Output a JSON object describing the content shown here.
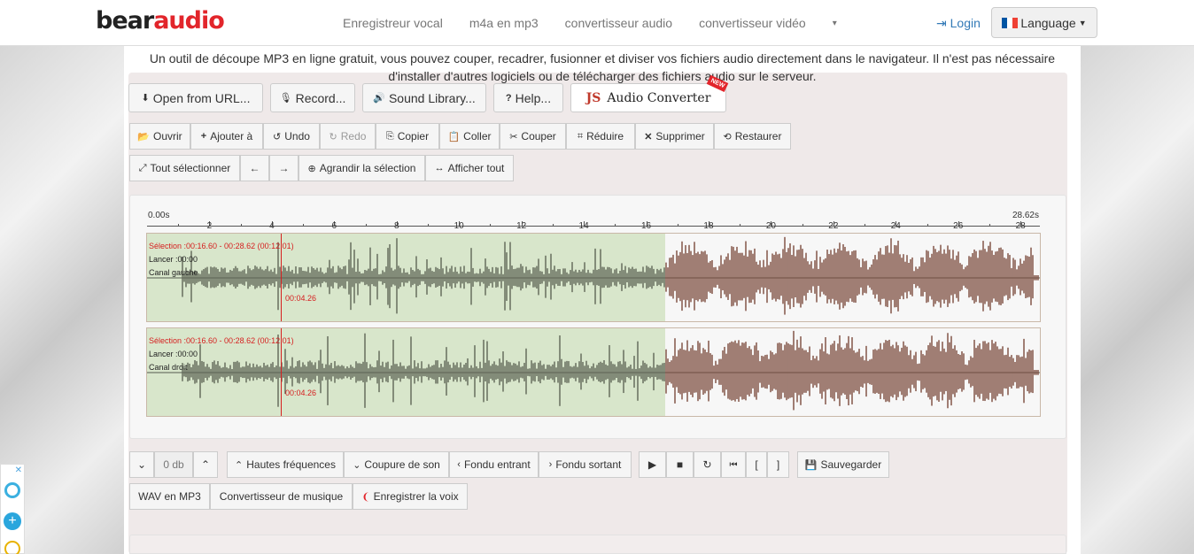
{
  "brand": {
    "logo_part1": "bear",
    "logo_part2": "audio"
  },
  "nav": {
    "links": [
      "Enregistreur vocal",
      "m4a en mp3",
      "convertisseur audio",
      "convertisseur vidéo"
    ],
    "dropdown_caret": "▾",
    "login": "Login",
    "language": "Language"
  },
  "intro_text": "Un outil de découpe MP3 en ligne gratuit, vous pouvez couper, recadrer, fusionner et diviser vos fichiers audio directement dans le navigateur. Il n'est pas nécessaire d'installer d'autres logiciels ou de télécharger des fichiers audio sur le serveur.",
  "source_buttons": {
    "open_url": "Open from URL...",
    "record": "Record...",
    "sound_library": "Sound Library...",
    "help": "Help...",
    "js_prefix": "JS",
    "audio_converter": "Audio Converter",
    "new_badge": "NEW"
  },
  "edit_toolbar": {
    "open": "Ouvrir",
    "append": "Ajouter à",
    "undo": "Undo",
    "redo": "Redo",
    "copy": "Copier",
    "paste": "Coller",
    "cut": "Couper",
    "crop": "Réduire",
    "delete": "Supprimer",
    "restore": "Restaurer"
  },
  "view_toolbar": {
    "select_all": "Tout sélectionner",
    "left_arrow": "←",
    "right_arrow": "→",
    "zoom_selection": "Agrandir la sélection",
    "show_all": "Afficher tout"
  },
  "timeline": {
    "start": "0.00s",
    "end": "28.62s",
    "ticks": [
      "2",
      "4",
      "6",
      "8",
      "10",
      "12",
      "14",
      "16",
      "18",
      "20",
      "22",
      "24",
      "26",
      "28"
    ]
  },
  "tracks": [
    {
      "selection": "Sélection :00:16.60 - 00:28.62 (00:12.01)",
      "play": "Lancer :00:00",
      "channel": "Canal gauche",
      "cursor_time": "00:04.26"
    },
    {
      "selection": "Sélection :00:16.60 - 00:28.62 (00:12.01)",
      "play": "Lancer :00:00",
      "channel": "Canal droit",
      "cursor_time": "00:04.26"
    }
  ],
  "effects_toolbar": {
    "volume_down": "⌄",
    "volume_value": "0 db",
    "volume_up": "⌃",
    "high_freq": "Hautes fréquences",
    "bass_cut": "Coupure de son",
    "fade_in": "Fondu entrant",
    "fade_out": "Fondu sortant",
    "play": "▶",
    "stop": "■",
    "loop": "↻",
    "skip_start": "⏮",
    "mark_in": "[",
    "mark_out": "]",
    "save": "Sauvegarder"
  },
  "links_toolbar": {
    "wav_mp3": "WAV en MP3",
    "music_converter": "Convertisseur de musique",
    "voice_recorder": "Enregistrer la voix"
  },
  "colors": {
    "brand_red": "#e2252b",
    "selection_fill": "#e2b3a0",
    "unselected_fill": "#d8e6cb",
    "waveform": "#5f6656",
    "waveform_sel": "#7a4a3c"
  }
}
